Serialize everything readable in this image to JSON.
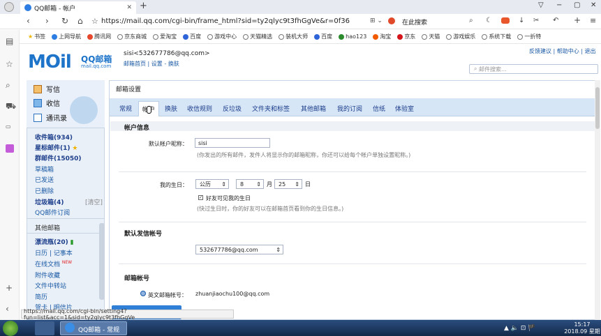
{
  "browser": {
    "tab_title": "QQ邮箱 - 帐户",
    "new_tab": "+",
    "url": "https://mail.qq.com/cgi-bin/frame_html?sid=ty2qlyc9t3fhGgVe&r=0f36",
    "search_engine": "在此搜索",
    "win_min": "▽",
    "win_restore": "−",
    "win_max": "▢",
    "win_close": "✕"
  },
  "bookmarks": [
    "书签",
    "上网导航",
    "腾讯网",
    "京东商城",
    "爱淘宝",
    "百度",
    "游戏中心",
    "天猫精选",
    "装机大师",
    "百度",
    "hao123",
    "淘宝",
    "京东",
    "天猫",
    "游戏娱乐",
    "系统下载",
    "一折特"
  ],
  "header": {
    "logo": "MOil",
    "logo_cn": "QQ邮箱",
    "logo_sub": "mail.qq.com",
    "user": "sisi<532677786@qq.com>",
    "user_links": "邮箱首页 | 设置 - 换肤",
    "top_links": "反馈建议 | 帮助中心 | 退出",
    "search_placeholder": "邮件搜索..."
  },
  "quick": {
    "write": "写信",
    "receive": "收信",
    "contacts": "通讯录"
  },
  "folders": {
    "inbox": "收件箱(934)",
    "starred": "星标邮件(1)",
    "group": "群邮件(15050)",
    "drafts": "草稿箱",
    "sent": "已发送",
    "deleted": "已删除",
    "spam": "垃圾箱(4)",
    "spam_clear": "[清空]",
    "subscribe": "QQ邮件订阅",
    "other": "其他邮箱",
    "drift": "漂流瓶(20)",
    "calendar": "日历 | 记事本",
    "docs": "在线文档",
    "docs_badge": "NEW",
    "attach": "附件收藏",
    "transfer": "文件中转站",
    "cards": "贺卡 | 明信片",
    "cards2": "简历"
  },
  "settings": {
    "title": "邮箱设置",
    "tabs": [
      "常规",
      "帐户",
      "换肤",
      "收信规则",
      "反垃圾",
      "文件夹和标签",
      "其他邮箱",
      "我的订阅",
      "信纸",
      "体验室"
    ],
    "account_info": "帐户信息",
    "nickname_label": "默认帐户昵称：",
    "nickname_value": "sisi",
    "nickname_hint": "(你发出的所有邮件，发件人将显示你的邮箱昵称，你还可以给每个帐户单独设置昵称。)",
    "birthday_label": "我的生日：",
    "calendar_type": "公历",
    "month": "8",
    "month_unit": "月",
    "day": "25",
    "day_unit": "日",
    "friends_see": "好友可见我的生日",
    "birthday_hint": "(快过生日时，你的好友可以在邮箱首页看到你的生日信息。)",
    "default_sender": "默认发信帐号",
    "sender_value": "532677786@qq.com",
    "mail_account": "邮箱帐号",
    "english_label": "英文邮箱帐号：",
    "english_value": "zhuanjiaochu100@qq.com"
  },
  "status_url": "https://mail.qq.com/cgi-bin/setting4?fun=list&acc=1&sid=ty2qlyc9t3fhGgVe",
  "taskbar": {
    "app": "QQ邮箱 - 常规",
    "time": "15:17",
    "date": "2018.09 星期一",
    "tray": "▲ 🔈 ⊡ 🏴"
  }
}
